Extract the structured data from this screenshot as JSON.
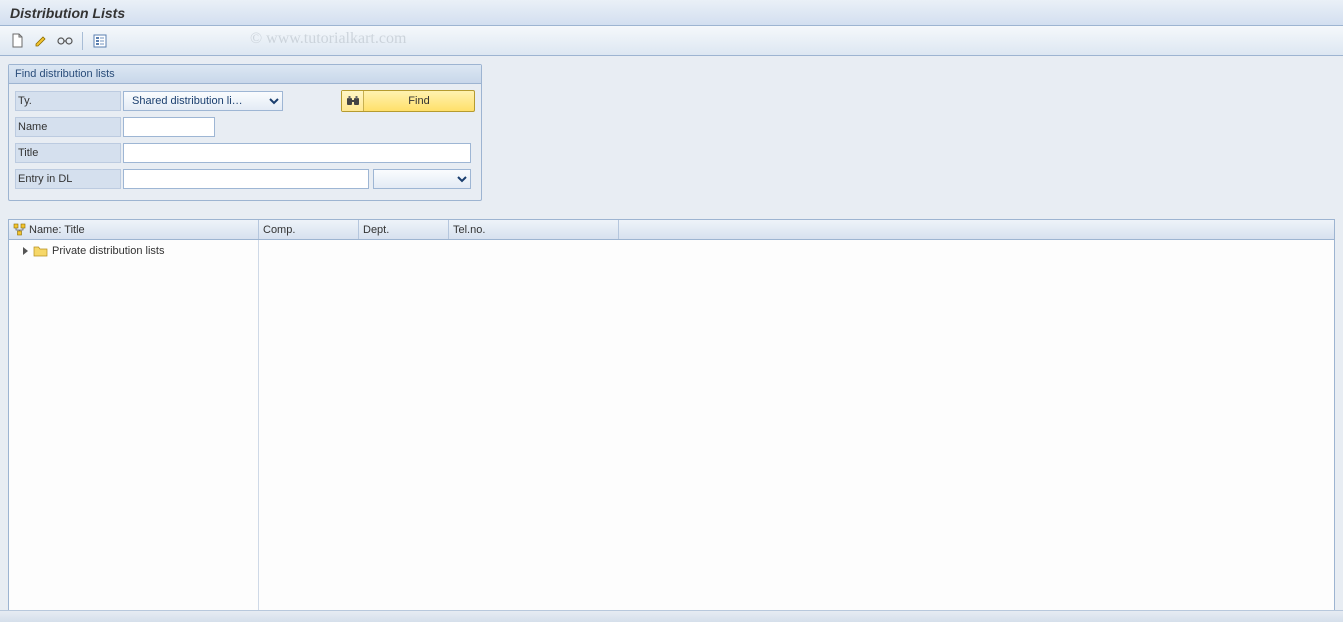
{
  "header": {
    "title": "Distribution Lists"
  },
  "watermark": "© www.tutorialkart.com",
  "toolbar": {
    "create_tt": "Create",
    "edit_tt": "Edit",
    "display_tt": "Display",
    "list_tt": "List"
  },
  "search": {
    "panel_title": "Find distribution lists",
    "labels": {
      "type": "Ty.",
      "name": "Name",
      "title": "Title",
      "entry": "Entry in DL"
    },
    "type_value": "Shared distribution li…",
    "find_label": "Find",
    "name_value": "",
    "title_value": "",
    "entry_value": "",
    "entry_select": ""
  },
  "table": {
    "cols": {
      "name_title": "Name: Title",
      "comp": "Comp.",
      "dept": "Dept.",
      "tel": "Tel.no."
    },
    "tree": [
      {
        "label": "Private distribution lists"
      }
    ]
  }
}
